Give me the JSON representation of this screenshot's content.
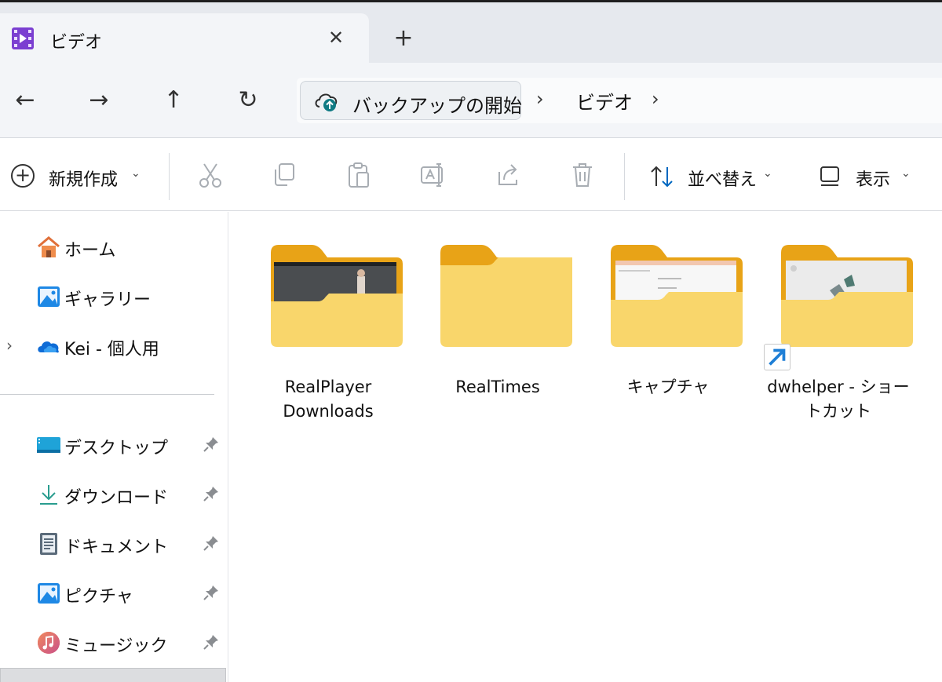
{
  "window": {
    "tab_title": "ビデオ",
    "close_glyph": "✕",
    "new_tab_glyph": "+",
    "tab_icon": "video-folder-icon"
  },
  "navigation": {
    "back_glyph": "←",
    "forward_glyph": "→",
    "up_glyph": "↑",
    "refresh_glyph": "↻"
  },
  "address": {
    "backup_label": "バックアップの開始",
    "backup_icon": "cloud-upload-icon",
    "separator": "›",
    "current_folder": "ビデオ"
  },
  "commands": {
    "new_label": "新規作成",
    "chevron": "⌄",
    "sort_label": "並べ替え",
    "view_label": "表示",
    "icons": [
      "cut-icon",
      "copy-icon",
      "paste-icon",
      "rename-icon",
      "share-icon",
      "delete-icon"
    ]
  },
  "sidebar": {
    "expand_glyph": "›",
    "top_items": [
      {
        "label": "ホーム",
        "icon": "home-icon"
      },
      {
        "label": "ギャラリー",
        "icon": "gallery-icon"
      },
      {
        "label": "Kei - 個人用",
        "icon": "onedrive-cloud-icon"
      }
    ],
    "pinned_items": [
      {
        "label": "デスクトップ",
        "icon": "desktop-icon"
      },
      {
        "label": "ダウンロード",
        "icon": "download-icon"
      },
      {
        "label": "ドキュメント",
        "icon": "documents-icon"
      },
      {
        "label": "ピクチャ",
        "icon": "pictures-icon"
      },
      {
        "label": "ミュージック",
        "icon": "music-icon"
      }
    ]
  },
  "files": [
    {
      "name_line1": "RealPlayer",
      "name_line2": "Downloads",
      "type": "folder-with-thumbnail"
    },
    {
      "name_line1": "RealTimes",
      "name_line2": "",
      "type": "folder"
    },
    {
      "name_line1": "キャプチャ",
      "name_line2": "",
      "type": "folder-with-thumbnail"
    },
    {
      "name_line1": "dwhelper - ショー",
      "name_line2": "トカット",
      "type": "folder-shortcut"
    }
  ],
  "colors": {
    "folder_back": "#e8a317",
    "folder_front": "#f9d66b",
    "accent": "#0067c0"
  }
}
